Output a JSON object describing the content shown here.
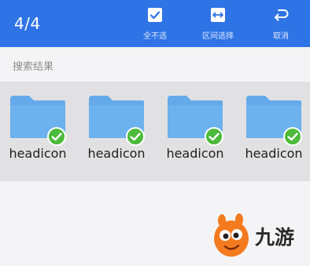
{
  "topbar": {
    "selection_count": "4/4",
    "actions": [
      {
        "label": "全不选",
        "icon": "checkbox-checked-icon"
      },
      {
        "label": "区间选择",
        "icon": "range-select-icon"
      },
      {
        "label": "取消",
        "icon": "undo-arrow-icon"
      }
    ]
  },
  "section": {
    "title": "搜索结果"
  },
  "results": [
    {
      "name": "headicon",
      "icon": "folder-icon",
      "selected": true
    },
    {
      "name": "headicon",
      "icon": "folder-icon",
      "selected": true
    },
    {
      "name": "headicon",
      "icon": "folder-icon",
      "selected": true
    },
    {
      "name": "headicon",
      "icon": "folder-icon",
      "selected": true
    }
  ],
  "watermark": {
    "text": "九游"
  },
  "colors": {
    "accent": "#2f74e6",
    "folder": "#64aaea",
    "check": "#4cba3a",
    "grid_bg": "#e1e1e4"
  }
}
